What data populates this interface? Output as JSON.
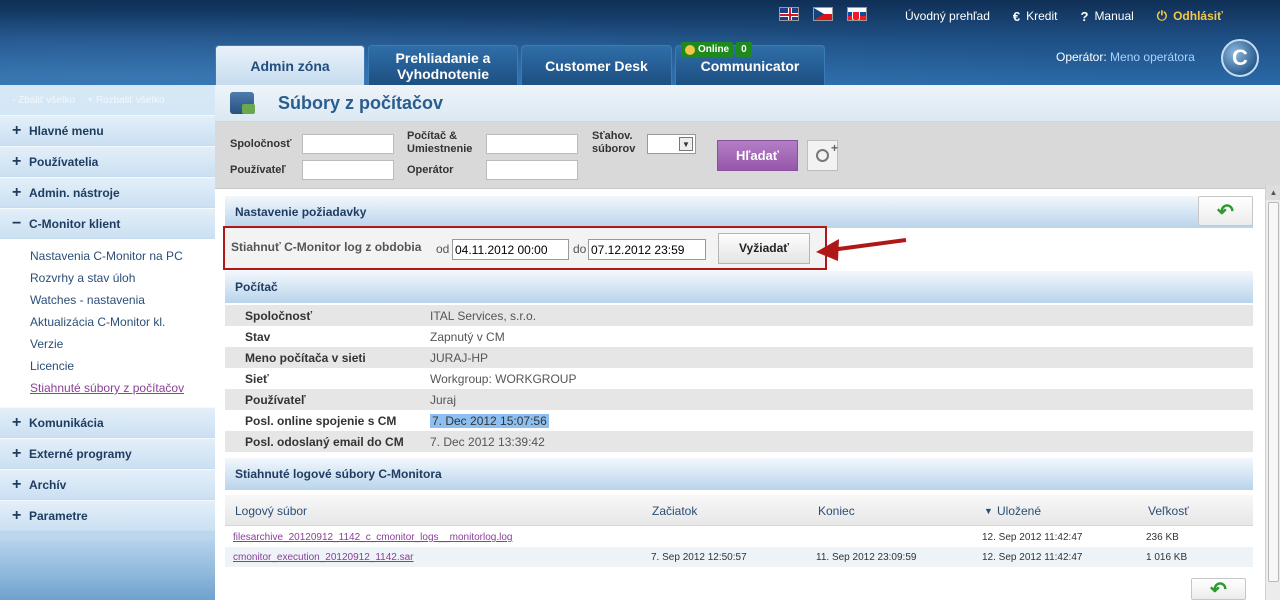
{
  "header": {
    "languages": [
      "English",
      "Czech",
      "Slovak"
    ],
    "links": [
      {
        "icon": "",
        "label": "Úvodný prehľad"
      },
      {
        "icon": "€",
        "label": "Kredit"
      },
      {
        "icon": "?",
        "label": "Manual"
      },
      {
        "icon": "⏻",
        "label": "Odhlásiť"
      }
    ],
    "tabs": [
      "Admin zóna",
      "Prehliadanie a Vyhodnotenie",
      "Customer Desk",
      "Communicator"
    ],
    "online": {
      "label": "Online",
      "count": "0"
    },
    "operator_label": "Operátor:",
    "operator_name": "Meno operátora",
    "logo": "C"
  },
  "sidebar": {
    "collapse_all": "- Zbaliť všetko",
    "expand_all": "+ Rozbaliť všetko",
    "groups_top": [
      {
        "sign": "+",
        "label": "Hlavné menu"
      },
      {
        "sign": "+",
        "label": "Používatelia"
      },
      {
        "sign": "+",
        "label": "Admin. nástroje"
      },
      {
        "sign": "−",
        "label": "C-Monitor klient"
      }
    ],
    "sub_items": [
      "Nastavenia C-Monitor na PC",
      "Rozvrhy a stav úloh",
      "Watches - nastavenia",
      "Aktualizácia C-Monitor kl.",
      "Verzie",
      "Licencie",
      "Stiahnuté súbory z počítačov"
    ],
    "groups_bottom": [
      {
        "sign": "+",
        "label": "Komunikácia"
      },
      {
        "sign": "+",
        "label": "Externé programy"
      },
      {
        "sign": "+",
        "label": "Archív"
      },
      {
        "sign": "+",
        "label": "Parametre"
      }
    ]
  },
  "page": {
    "title": "Súbory z počítačov"
  },
  "filters": {
    "company_label": "Spoločnosť",
    "user_label": "Používateľ",
    "computer_label": "Počítač & Umiestnenie",
    "operator_label": "Operátor",
    "download_label": "Sťahov. súborov",
    "search_button": "Hľadať"
  },
  "request": {
    "section_title": "Nastavenie požiadavky",
    "label": "Stiahnuť C-Monitor log z obdobia",
    "from_label": "od",
    "from_value": "04.11.2012 00:00",
    "to_label": "do",
    "to_value": "07.12.2012 23:59",
    "button": "Vyžiadať"
  },
  "computer": {
    "section_title": "Počítač",
    "rows": [
      {
        "key": "Spoločnosť",
        "value": "ITAL Services, s.r.o."
      },
      {
        "key": "Stav",
        "value": "Zapnutý v CM"
      },
      {
        "key": "Meno počítača v sieti",
        "value": "JURAJ-HP"
      },
      {
        "key": "Sieť",
        "value": "Workgroup: WORKGROUP"
      },
      {
        "key": "Používateľ",
        "value": "Juraj"
      },
      {
        "key": "Posl. online spojenie s CM",
        "value": "7. Dec 2012 15:07:56"
      },
      {
        "key": "Posl. odoslaný email do CM",
        "value": "7. Dec 2012 13:39:42"
      }
    ]
  },
  "files": {
    "section_title": "Stiahnuté logové súbory C-Monitora",
    "columns": [
      "Logový súbor",
      "Začiatok",
      "Koniec",
      "Uložené",
      "Veľkosť"
    ],
    "rows": [
      {
        "file": "filesarchive_20120912_1142_c_cmonitor_logs__monitorlog.log",
        "start": "",
        "end": "",
        "saved": "12. Sep 2012 11:42:47",
        "size": "236 KB"
      },
      {
        "file": "cmonitor_execution_20120912_1142.sar",
        "start": "7. Sep 2012 12:50:57",
        "end": "11. Sep 2012 23:09:59",
        "saved": "12. Sep 2012 11:42:47",
        "size": "1 016 KB"
      }
    ]
  },
  "colors": {
    "header_top": "#0f2f55",
    "header_bottom": "#2a6aa8",
    "accent_purple": "#9557aa",
    "highlight_box": "#b01818",
    "link_visited": "#8a3f98"
  }
}
